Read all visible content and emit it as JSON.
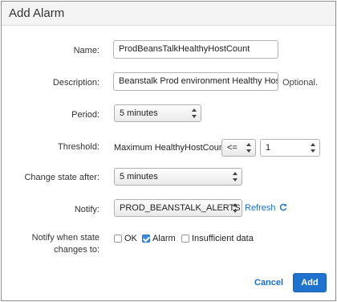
{
  "dialog": {
    "title": "Add Alarm"
  },
  "name": {
    "label": "Name:",
    "value": "ProdBeansTalkHealthyHostCount"
  },
  "description": {
    "label": "Description:",
    "value": "Beanstalk Prod environment Healthy Host Count",
    "hint": "Optional."
  },
  "period": {
    "label": "Period:",
    "selected": "5 minutes"
  },
  "threshold": {
    "label": "Threshold:",
    "statistic_metric": "Maximum HealthyHostCount",
    "operator": "<=",
    "value": "1"
  },
  "change_state": {
    "label": "Change state after:",
    "selected": "5 minutes"
  },
  "notify": {
    "label": "Notify:",
    "selected": "PROD_BEANSTALK_ALERTS",
    "refresh_label": "Refresh"
  },
  "notify_when": {
    "label_line1": "Notify when state",
    "label_line2": "changes to:",
    "options": [
      {
        "label": "OK",
        "checked": false
      },
      {
        "label": "Alarm",
        "checked": true
      },
      {
        "label": "Insufficient data",
        "checked": false
      }
    ]
  },
  "actions": {
    "cancel_label": "Cancel",
    "add_label": "Add"
  },
  "colors": {
    "accent": "#1f73cf",
    "link": "#1a6fc9",
    "header_bg": "#f4f4f4"
  },
  "icons": {
    "refresh": "refresh-icon",
    "updown": "updown-arrows-icon"
  }
}
